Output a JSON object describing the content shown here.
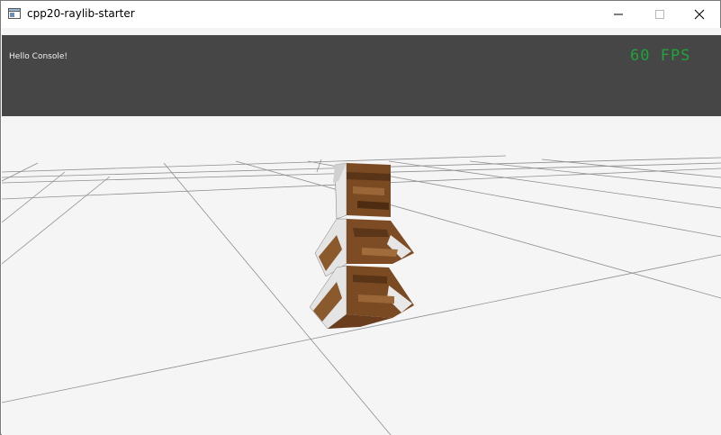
{
  "window": {
    "title": "cpp20-raylib-starter",
    "app_icon": "window-app-icon",
    "controls": [
      "minimize-icon",
      "maximize-icon",
      "close-icon"
    ]
  },
  "overlay": {
    "console_text": "Hello Console!",
    "fps_text": "60 FPS"
  },
  "colors": {
    "console_bg": "#464646",
    "fps": "#1fa33a",
    "viewport_bg": "#f5f5f5",
    "grid": "#8a8a8a",
    "cube_wood": "#7a4a22"
  },
  "scene": {
    "object": "stacked-textured-cubes",
    "grid": true
  }
}
